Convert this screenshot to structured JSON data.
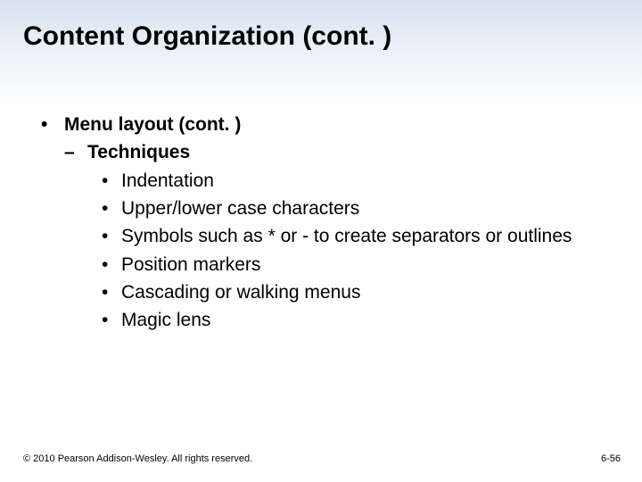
{
  "title": "Content Organization (cont. )",
  "l1_text": "Menu layout (cont. )",
  "l2_text": "Techniques",
  "items": {
    "0": "Indentation",
    "1": "Upper/lower case characters",
    "2": "Symbols such as * or - to create separators or outlines",
    "3": "Position markers",
    "4": "Cascading or walking menus",
    "5": "Magic lens"
  },
  "copyright": "© 2010 Pearson Addison-Wesley. All rights reserved.",
  "page_num": "6-56"
}
